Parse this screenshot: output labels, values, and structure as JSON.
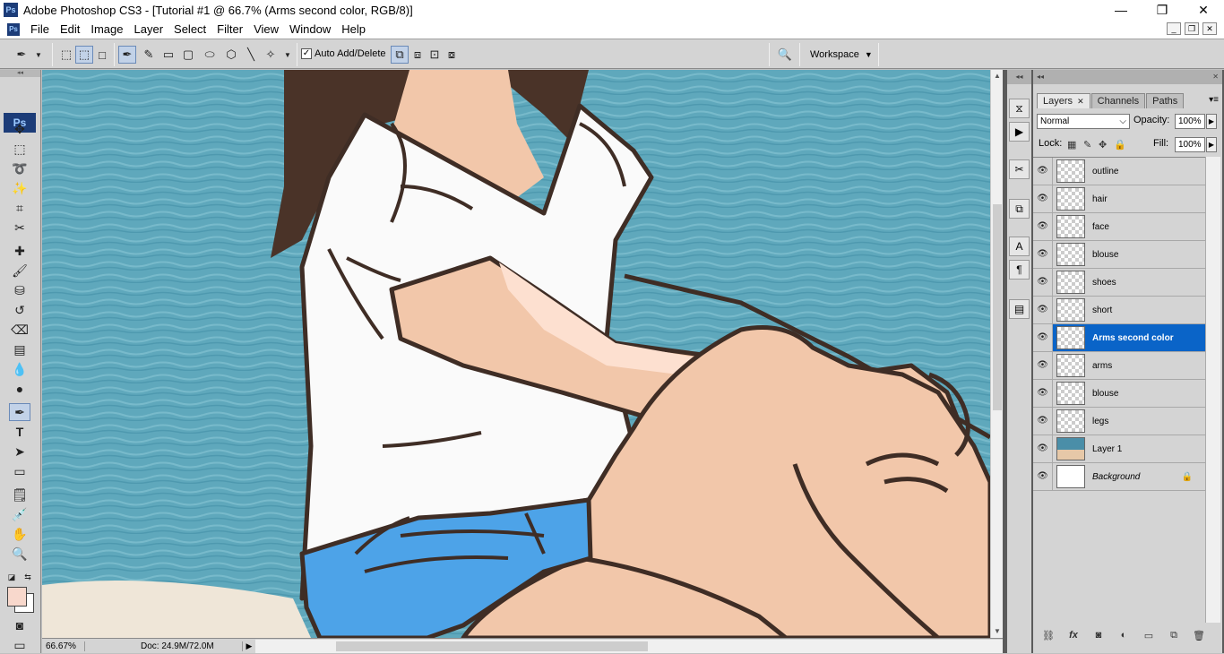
{
  "window": {
    "title": "Adobe Photoshop CS3 - [Tutorial #1 @ 66.7% (Arms second color, RGB/8)]",
    "logo": "Ps",
    "minimize": "—",
    "maximize": "❐",
    "close": "✕"
  },
  "menu": {
    "items": [
      "File",
      "Edit",
      "Image",
      "Layer",
      "Select",
      "Filter",
      "View",
      "Window",
      "Help"
    ],
    "doc_buttons": [
      "_",
      "❐",
      "✕"
    ]
  },
  "options": {
    "auto_add_delete_label": "Auto Add/Delete",
    "auto_add_delete_checked": "✓",
    "workspace_label": "Workspace",
    "workspace_arrow": "▼"
  },
  "toolbox": {
    "badge": "Ps",
    "grip": "◂◂"
  },
  "status": {
    "zoom": "66.67%",
    "doc": "Doc: 24.9M/72.0M",
    "arrow": "▶"
  },
  "colors": {
    "foreground": "#f8d8cc",
    "background": "#ffffff",
    "selection": "#0a64c8",
    "sea": "#5fa8bc",
    "shorts": "#4da3e8",
    "skin": "#f2c7aa",
    "skin_highlight": "#fde0d0",
    "hair": "#4a3328",
    "outline": "#3f2d25",
    "blouse": "#fafafa"
  },
  "layers_panel": {
    "tabs": [
      {
        "label": "Layers",
        "active": true,
        "close": "✕"
      },
      {
        "label": "Channels",
        "active": false
      },
      {
        "label": "Paths",
        "active": false
      }
    ],
    "blend_mode": "Normal",
    "opacity_label": "Opacity:",
    "opacity_value": "100%",
    "lock_label": "Lock:",
    "fill_label": "Fill:",
    "fill_value": "100%",
    "grip_arrows": "◂◂",
    "close": "✕",
    "layers": [
      {
        "name": "outline",
        "thumb": "transparent",
        "selected": false,
        "italic": false
      },
      {
        "name": "hair",
        "thumb": "transparent",
        "selected": false,
        "italic": false
      },
      {
        "name": "face",
        "thumb": "transparent",
        "selected": false,
        "italic": false
      },
      {
        "name": "blouse",
        "thumb": "transparent",
        "selected": false,
        "italic": false
      },
      {
        "name": "shoes",
        "thumb": "transparent",
        "selected": false,
        "italic": false
      },
      {
        "name": "short",
        "thumb": "transparent",
        "selected": false,
        "italic": false
      },
      {
        "name": "Arms second color",
        "thumb": "transparent",
        "selected": true,
        "italic": false
      },
      {
        "name": "arms",
        "thumb": "transparent",
        "selected": false,
        "italic": false
      },
      {
        "name": "blouse",
        "thumb": "transparent",
        "selected": false,
        "italic": false
      },
      {
        "name": "legs",
        "thumb": "transparent",
        "selected": false,
        "italic": false
      },
      {
        "name": "Layer 1",
        "thumb": "photo",
        "selected": false,
        "italic": false
      },
      {
        "name": "Background",
        "thumb": "white",
        "selected": false,
        "italic": true,
        "locked": true
      }
    ],
    "footer_icons": [
      "link-icon",
      "fx-icon",
      "mask-icon",
      "adjustment-icon",
      "group-icon",
      "new-layer-icon",
      "trash-icon"
    ]
  }
}
